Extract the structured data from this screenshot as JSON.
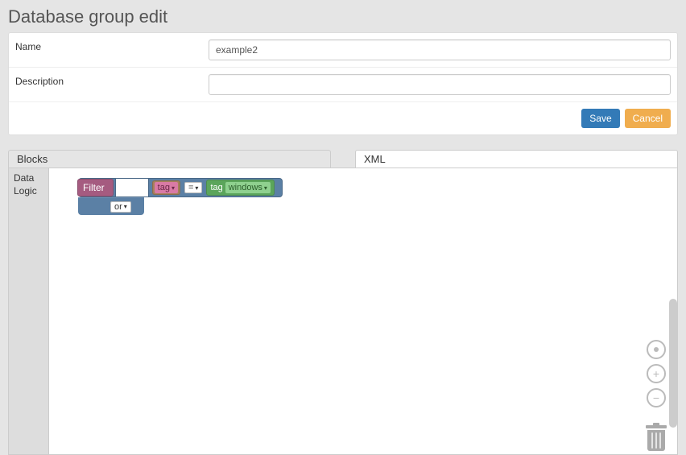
{
  "page": {
    "title": "Database group edit"
  },
  "form": {
    "name_label": "Name",
    "name_value": "example2",
    "description_label": "Description",
    "description_value": ""
  },
  "actions": {
    "save": "Save",
    "cancel": "Cancel"
  },
  "tabs": {
    "blocks": "Blocks",
    "xml": "XML"
  },
  "toolbox": {
    "items": [
      "Data",
      "Logic"
    ]
  },
  "filter_block": {
    "label": "Filter",
    "left_tag_dropdown": "tag",
    "operator": "=",
    "right_tag_prefix": "tag",
    "right_tag_value": "windows",
    "logic_connector": "or"
  }
}
